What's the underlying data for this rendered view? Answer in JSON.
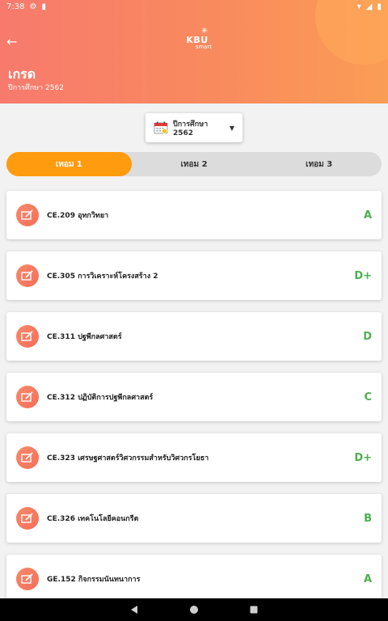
{
  "status_bar": {
    "time": "7:38"
  },
  "header": {
    "logo_text": "KBU",
    "logo_sub": "smart",
    "title": "เกรด",
    "subtitle": "ปีการศึกษา 2562"
  },
  "year_select": {
    "label": "ปีการศึกษา 2562"
  },
  "tabs": [
    {
      "label": "เทอม 1"
    },
    {
      "label": "เทอม 2"
    },
    {
      "label": "เทอม 3"
    }
  ],
  "courses": [
    {
      "name": "CE.209 อุทกวิทยา",
      "grade": "A"
    },
    {
      "name": "CE.305 การวิเคราะห์โครงสร้าง 2",
      "grade": "D+"
    },
    {
      "name": "CE.311 ปฐพีกลศาสตร์",
      "grade": "D"
    },
    {
      "name": "CE.312 ปฏิบัติการปฐพีกลศาสตร์",
      "grade": "C"
    },
    {
      "name": "CE.323 เศรษฐศาสตร์วิศวกรรมสำหรับวิศวกรโยธา",
      "grade": "D+"
    },
    {
      "name": "CE.326 เทคโนโลยีคอนกรีต",
      "grade": "B"
    },
    {
      "name": "GE.152 กิจกรรมนันทนาการ",
      "grade": "A"
    }
  ],
  "colors": {
    "header_start": "#f77a6d",
    "header_end": "#fb9d55",
    "tab_active": "#ff9b0e",
    "grade_green": "#4caf50"
  }
}
